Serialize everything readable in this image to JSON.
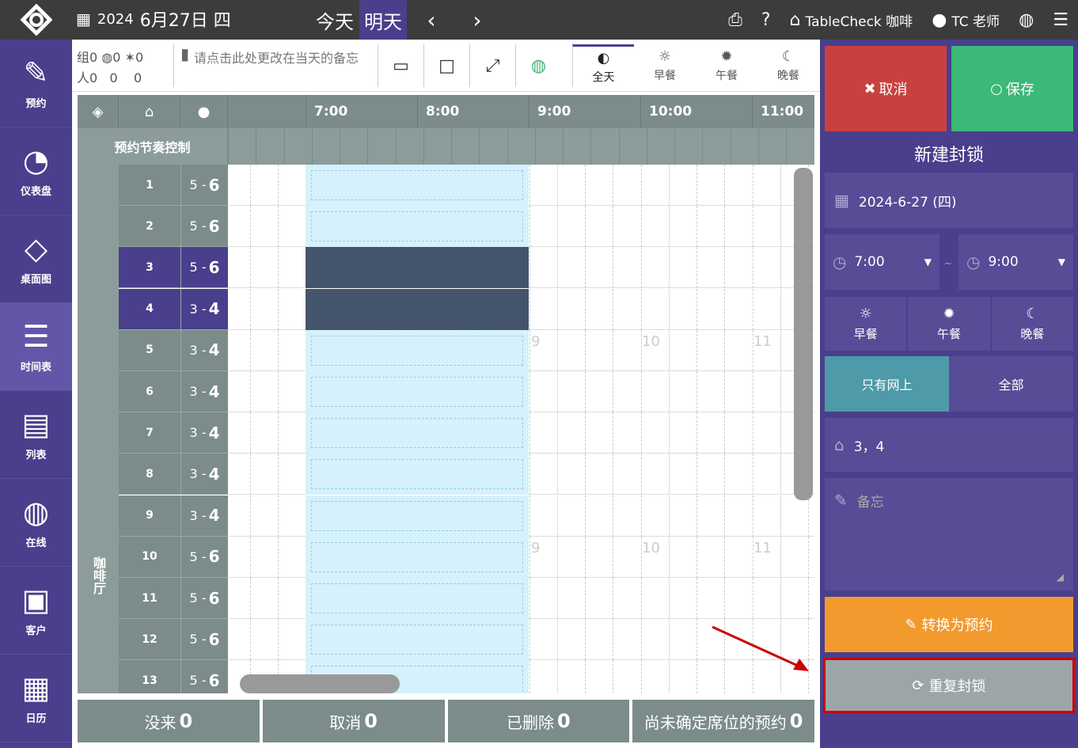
{
  "topbar": {
    "date_year": "2024",
    "date_main": "6月27日 四",
    "today_label": "今天",
    "tomorrow_label": "明天",
    "restaurant": "TableCheck 咖啡",
    "user": "TC 老师"
  },
  "sidebar": {
    "items": [
      {
        "label": "预约",
        "icon": "edit-icon"
      },
      {
        "label": "仪表盘",
        "icon": "dashboard-icon"
      },
      {
        "label": "桌面图",
        "icon": "floorplan-icon"
      },
      {
        "label": "时间表",
        "icon": "timetable-icon"
      },
      {
        "label": "列表",
        "icon": "list-icon"
      },
      {
        "label": "在线",
        "icon": "globe-icon"
      },
      {
        "label": "客户",
        "icon": "customer-icon"
      },
      {
        "label": "日历",
        "icon": "calendar-icon"
      }
    ],
    "active_index": 3
  },
  "toolbar": {
    "group_label": "组",
    "group_count": "0",
    "group_web": "0",
    "group_walk": "0",
    "people_label": "人",
    "people_count": "0",
    "people_web": "0",
    "people_walk": "0",
    "memo_placeholder": "请点击此处更改在当天的备忘",
    "shifts": [
      "全天",
      "早餐",
      "午餐",
      "晚餐"
    ],
    "active_shift": 0
  },
  "grid": {
    "pace_label": "预约节奏控制",
    "area_label": "咖啡厅",
    "times": [
      "7:00",
      "8:00",
      "9:00",
      "10:00",
      "11:00"
    ],
    "rows": [
      {
        "table": "1",
        "min": "5",
        "max": "6"
      },
      {
        "table": "2",
        "min": "5",
        "max": "6"
      },
      {
        "table": "3",
        "min": "5",
        "max": "6"
      },
      {
        "table": "4",
        "min": "3",
        "max": "4"
      },
      {
        "table": "5",
        "min": "3",
        "max": "4"
      },
      {
        "table": "6",
        "min": "3",
        "max": "4"
      },
      {
        "table": "7",
        "min": "3",
        "max": "4"
      },
      {
        "table": "8",
        "min": "3",
        "max": "4"
      },
      {
        "table": "9",
        "min": "3",
        "max": "4"
      },
      {
        "table": "10",
        "min": "5",
        "max": "6"
      },
      {
        "table": "11",
        "min": "5",
        "max": "6"
      },
      {
        "table": "12",
        "min": "5",
        "max": "6"
      },
      {
        "table": "13",
        "min": "5",
        "max": "6"
      }
    ],
    "selected_rows": [
      2,
      3
    ],
    "ghost_hours": [
      "9",
      "10",
      "11"
    ]
  },
  "footer": {
    "noshow_label": "没来",
    "noshow_count": "0",
    "cancel_label": "取消",
    "cancel_count": "0",
    "deleted_label": "已删除",
    "deleted_count": "0",
    "unassigned_label": "尚未确定席位的预约",
    "unassigned_count": "0"
  },
  "panel": {
    "cancel_label": "取消",
    "save_label": "保存",
    "title": "新建封锁",
    "date": "2024-6-27 (四)",
    "start_time": "7:00",
    "end_time": "9:00",
    "tilde": "~",
    "meals": [
      "早餐",
      "午餐",
      "晚餐"
    ],
    "filter_online": "只有网上",
    "filter_all": "全部",
    "tables": "3，4",
    "memo_placeholder": "备忘",
    "convert_label": "转换为预约",
    "repeat_label": "重复封锁"
  },
  "colors": {
    "brand": "#4a3f8c",
    "cancel": "#c9413f",
    "save": "#3cb878",
    "convert": "#f29a2e",
    "highlight": "#cc0000",
    "block": "#d5f1fb",
    "blocked": "#44546a"
  }
}
